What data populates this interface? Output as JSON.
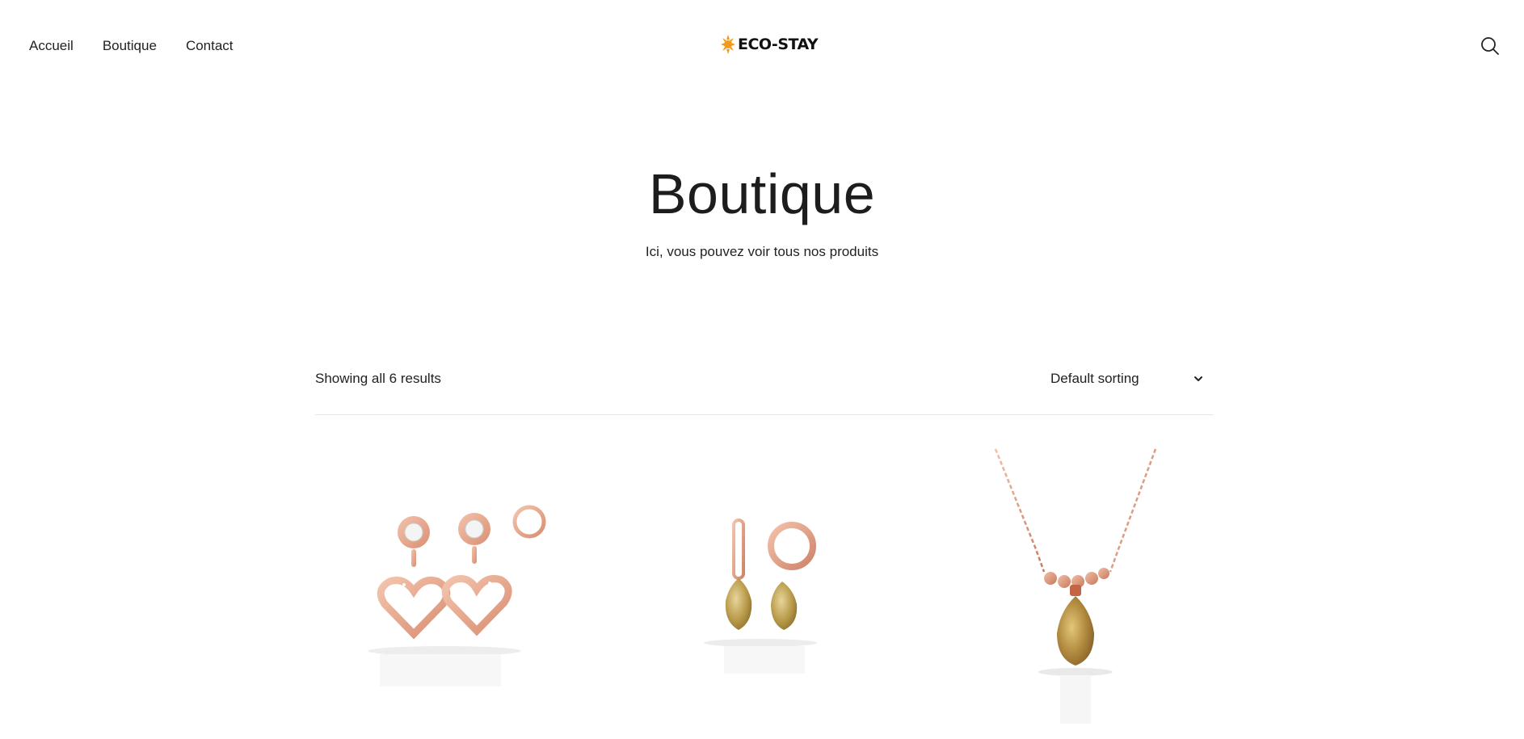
{
  "nav": {
    "items": [
      {
        "label": "Accueil"
      },
      {
        "label": "Boutique"
      },
      {
        "label": "Contact"
      }
    ]
  },
  "logo": {
    "text": "ECO-STAY",
    "mark_color": "#f29a1a"
  },
  "search": {
    "icon": "search-icon"
  },
  "hero": {
    "title": "Boutique",
    "subtitle": "Ici, vous pouvez voir tous nos produits"
  },
  "toolbar": {
    "results_text": "Showing all 6 results",
    "sorting_selected": "Default sorting"
  },
  "products": [
    {
      "image": "rose-gold-heart-drop-earrings"
    },
    {
      "image": "rose-gold-hoop-earrings-with-citrine-drops"
    },
    {
      "image": "rose-gold-necklace-with-citrine-pendant"
    }
  ],
  "colors": {
    "text": "#222222",
    "rose_gold": "#e0a68c",
    "divider": "#e6e6e6"
  }
}
